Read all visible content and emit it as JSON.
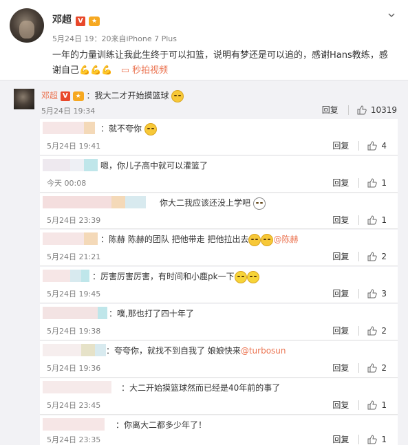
{
  "post": {
    "author": "邓超",
    "verified_badge": "V",
    "vip_badge": "会员",
    "meta": "5月24日 19：20来自iPhone 7 Plus",
    "text": "一年的力量训练让我此生终于可以扣篮，说明有梦还是可以追的，感谢Hans教练，感谢自己",
    "arm_emojis": "💪💪💪",
    "video_link": "秒拍视频"
  },
  "top_comment": {
    "author": "邓超",
    "text": "：我大二才开始摸篮球",
    "date": "5月24日 19:34",
    "reply_label": "回复",
    "likes": "10319"
  },
  "replies": [
    {
      "text": "：就不夸你",
      "date": "5月24日 19:41",
      "reply_label": "回复",
      "likes": "4"
    },
    {
      "text": "嗯，你儿子高中就可以灌篮了",
      "date": "今天 00:08",
      "reply_label": "回复",
      "likes": "1"
    },
    {
      "text": "你大二我应该还没上学吧",
      "date": "5月24日 23:39",
      "reply_label": "回复",
      "likes": "1"
    },
    {
      "text": "：陈赫   陈赫的团队   把他带走   把他拉出去",
      "mention": "@陈赫",
      "date": "5月24日 21:21",
      "reply_label": "回复",
      "likes": "2"
    },
    {
      "text": "：厉害厉害厉害，有时间和小鹿pk一下",
      "date": "5月24日 19:45",
      "reply_label": "回复",
      "likes": "3"
    },
    {
      "text": "：噗,那也打了四十年了",
      "date": "5月24日 19:38",
      "reply_label": "回复",
      "likes": "2"
    },
    {
      "text": "：夸夸你，就找不到自我了 娘娘快来",
      "mention": "@turbosun",
      "date": "5月24日 19:36",
      "reply_label": "回复",
      "likes": "2"
    },
    {
      "text": "：大二开始摸篮球然而已经是40年前的事了",
      "date": "5月24日 23:45",
      "reply_label": "回复",
      "likes": "1"
    },
    {
      "text": "：你离大二都多少年了！",
      "date": "5月24日 23:35",
      "reply_label": "回复",
      "likes": "1"
    }
  ],
  "colors": {
    "accent": "#eb7350",
    "meta_gray": "#808080",
    "panel_bg": "#f2f2f5"
  }
}
